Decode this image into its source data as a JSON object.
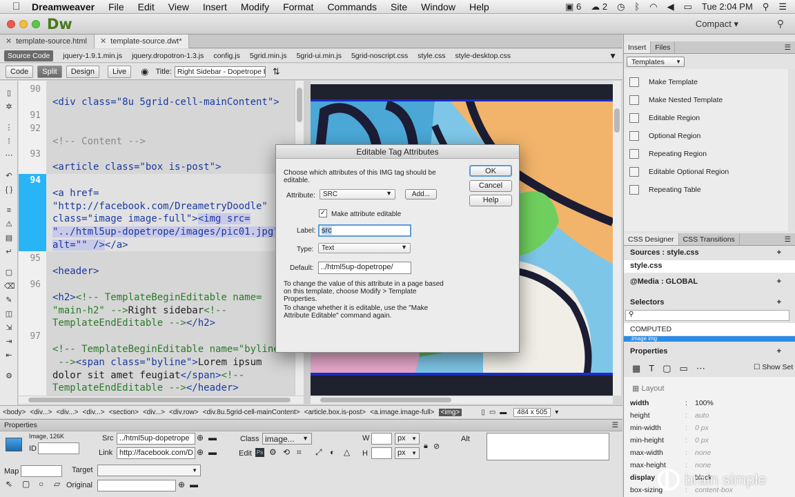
{
  "menubar": {
    "app_name": "Dreamweaver",
    "items": [
      "File",
      "Edit",
      "View",
      "Insert",
      "Modify",
      "Format",
      "Commands",
      "Site",
      "Window",
      "Help"
    ],
    "status_items": [
      "6",
      "2",
      "Tue 2:04 PM"
    ]
  },
  "titlebar": {
    "logo": "Dw",
    "workspace": "Compact",
    "workspace_arrow": "▾"
  },
  "doc_tabs": [
    {
      "label": "template-source.html"
    },
    {
      "label": "template-source.dwt*"
    }
  ],
  "related_files": [
    "Source Code",
    "jquery-1.9.1.min.js",
    "jquery.dropotron-1.3.js",
    "config.js",
    "5grid.min.js",
    "5grid-ui.min.js",
    "5grid-noscript.css",
    "style.css",
    "style-desktop.css"
  ],
  "view_bar": {
    "code": "Code",
    "split": "Split",
    "design": "Design",
    "live": "Live",
    "title_label": "Title:",
    "title_value": "Right Sidebar - Dopetrope by"
  },
  "code_lines": {
    "n90": "90",
    "n91": "91",
    "n92": "92",
    "n93": "93",
    "n94": "94",
    "n95": "95",
    "n96": "96",
    "n97": "97",
    "l1": "<div class=\"8u 5grid-cell-mainContent\">",
    "l2": "<!-- Content -->",
    "l3": "<article class=\"box is-post\">",
    "l4": "<a href=",
    "l5": "\"http://facebook.com/DreametryDoodle\"",
    "l6a": "class=\"image image-full\">",
    "l6b": "<img src=",
    "l7": "\"../html5up-dopetrope/images/pic01.jpg\"",
    "l8": "alt=\"\" />",
    "l8b": "</a>",
    "l9": "<header>",
    "l10a": "<h2>",
    "l10b": "<!-- TemplateBeginEditable name=",
    "l11a": "\"main-h2\" -->",
    "l11b": "Right sidebar",
    "l11c": "<!--",
    "l12a": "TemplateEndEditable -->",
    "l12b": "</h2>",
    "l13": "<!-- TemplateBeginEditable name=\"byline\"",
    "l14a": " -->",
    "l14b": "<span class=\"byline\">",
    "l14c": "Lorem ipsum",
    "l15a": "dolor sit amet feugiat",
    "l15b": "</span>",
    "l15c": "<!--",
    "l16a": "TemplateEndEditable -->",
    "l16b": "</header>"
  },
  "status_bar": {
    "tags": [
      "<body>",
      "<div...>",
      "<div...>",
      "<div...>",
      "<section>",
      "<div...>",
      "<div.row>",
      "<div.8u.5grid-cell-mainContent>",
      "<article.box.is-post>",
      "<a.image.image-full>"
    ],
    "selected_tag": "<img>",
    "size": "484 x 505"
  },
  "properties": {
    "header": "Properties",
    "kind": "Image, 126K",
    "id_label": "ID",
    "src_label": "Src",
    "src_value": "../html5up-dopetrope",
    "link_label": "Link",
    "link_value": "http://facebook.com/D",
    "class_label": "Class",
    "class_value": "image...",
    "edit_label": "Edit",
    "w_label": "W",
    "h_label": "H",
    "unit_w": "px",
    "unit_h": "px",
    "alt_label": "Alt",
    "map_label": "Map",
    "target_label": "Target",
    "original_label": "Original"
  },
  "insert_panel": {
    "tabs": [
      "Insert",
      "Files"
    ],
    "category": "Templates",
    "items": [
      "Make Template",
      "Make Nested Template",
      "Editable Region",
      "Optional Region",
      "Repeating Region",
      "Editable Optional Region",
      "Repeating Table"
    ]
  },
  "css_designer": {
    "tabs": [
      "CSS Designer",
      "CSS Transitions"
    ],
    "sources_label": "Sources : style.css",
    "source_selected": "style.css",
    "media_label": "@Media : GLOBAL",
    "selectors_label": "Selectors",
    "computed": "COMPUTED",
    "selected_selector": ".image img",
    "properties_label": "Properties",
    "show_set": "Show Set",
    "layout_label": "Layout",
    "props": [
      {
        "name": "width",
        "value": "100%",
        "bold": true
      },
      {
        "name": "height",
        "value": "auto",
        "bold": false
      },
      {
        "name": "min-width",
        "value": "0 px",
        "bold": false
      },
      {
        "name": "min-height",
        "value": "0 px",
        "bold": false
      },
      {
        "name": "max-width",
        "value": "none",
        "bold": false
      },
      {
        "name": "max-height",
        "value": "none",
        "bold": false
      },
      {
        "name": "display",
        "value": "block",
        "bold": true
      },
      {
        "name": "box-sizing",
        "value": "content-box",
        "bold": false
      }
    ]
  },
  "dialog": {
    "title": "Editable Tag Attributes",
    "intro": "Choose which attributes of this IMG tag should be editable.",
    "attribute_label": "Attribute:",
    "attribute_value": "SRC",
    "add_button": "Add...",
    "checkbox_label": "Make attribute editable",
    "label_label": "Label:",
    "label_value": "src",
    "type_label": "Type:",
    "type_value": "Text",
    "default_label": "Default:",
    "default_value": "../html5up-dopetrope/",
    "note1": "To change the value of this attribute in a page based on this template, choose Modify > Template Properties.",
    "note2": "To change whether it is editable, use the \"Make Attribute Editable\" command again.",
    "ok": "OK",
    "cancel": "Cancel",
    "help": "Help"
  },
  "watermark": "brain simple",
  "colors": {
    "accent": "#2b8ce8",
    "code_tag": "#1a3aa0",
    "template_green": "#2a7a2a",
    "dw_green": "#4a7a1e"
  }
}
